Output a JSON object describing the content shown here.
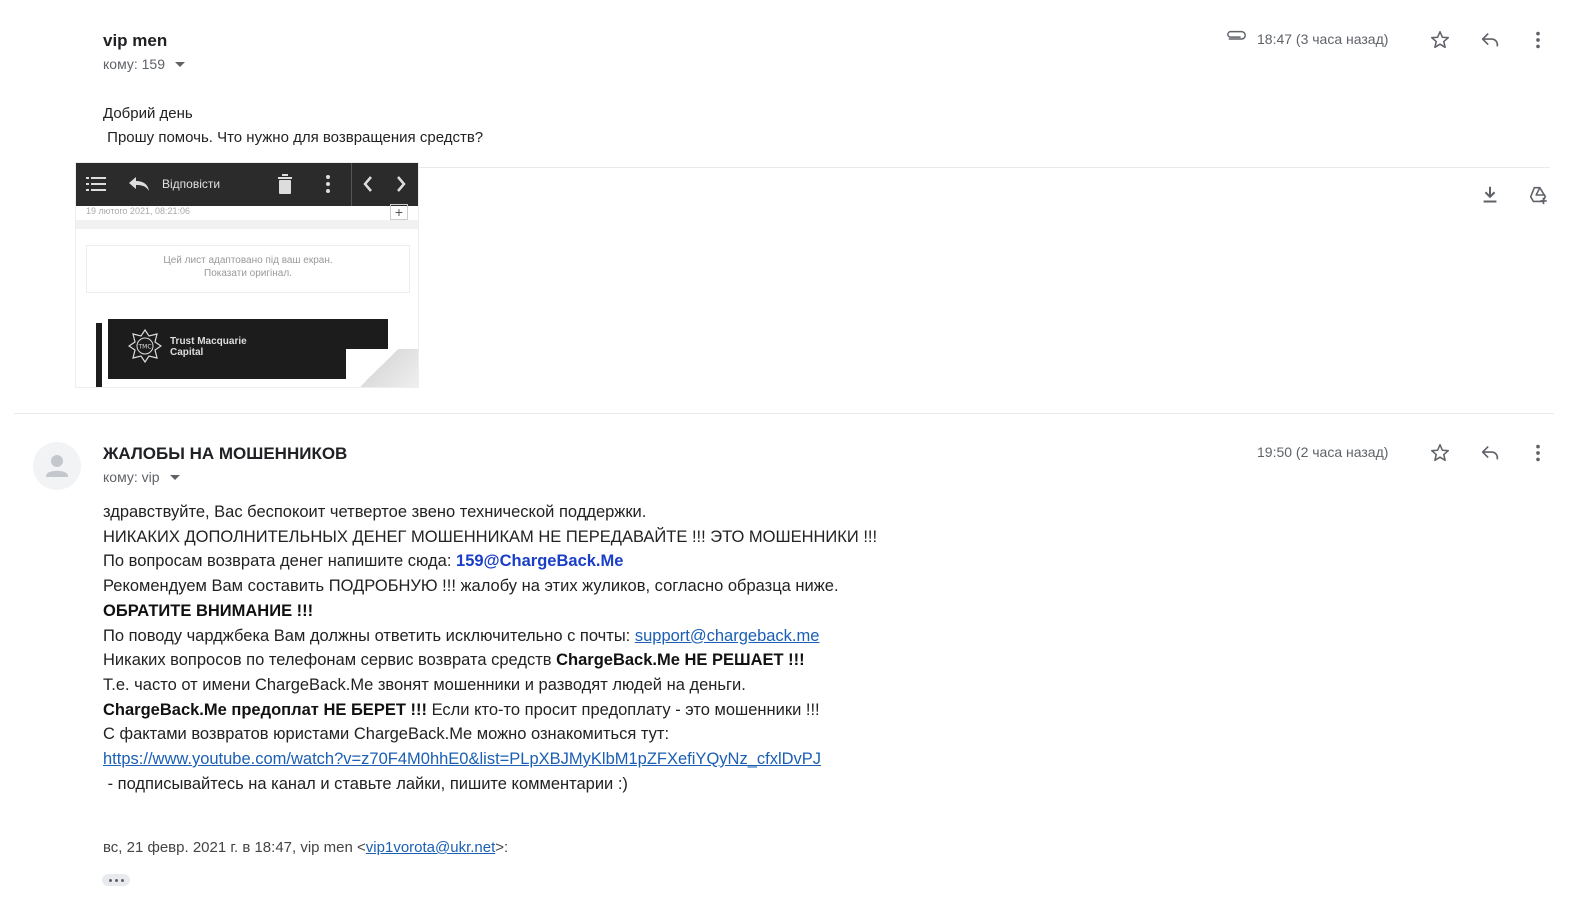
{
  "message1": {
    "sender": "vip men",
    "recipient": "кому: 159",
    "time": "18:47 (3 часа назад)",
    "body": [
      "Добрий день",
      " Прошу помочь. Что нужно для возвращения средств?"
    ],
    "attachment": {
      "toolbar_label": "Відповісти",
      "date": "19 лютого 2021, 08:21:06",
      "notice_line1": "Цей лист адаптовано під ваш екран.",
      "notice_line2": "Показати оригінал.",
      "brand_line1": "Trust Macquarie",
      "brand_line2": "Capital",
      "brand_mark": "TMC"
    },
    "icons": [
      "attachment-icon",
      "star-icon",
      "reply-icon",
      "more-icon",
      "download-icon",
      "drive-add-icon"
    ]
  },
  "message2": {
    "sender": "ЖАЛОБЫ НА МОШЕННИКОВ",
    "recipient": "кому: vip",
    "time": "19:50 (2 часа назад)",
    "line1": "здравствуйте, Вас беспокоит четвертое звено технической поддержки.",
    "line2": "НИКАКИХ ДОПОЛНИТЕЛЬНЫХ ДЕНЕГ МОШЕННИКАМ НЕ ПЕРЕДАВАЙТЕ !!! ЭТО МОШЕННИКИ !!!",
    "line3_prefix": "По вопросам возврата денег напишите сюда: ",
    "line3_email": "159@ChargeBack.Me",
    "line4": "Рекомендуем Вам составить ПОДРОБНУЮ !!! жалобу на этих жуликов, согласно образца ниже.",
    "line5": "ОБРАТИТЕ ВНИМАНИЕ !!!",
    "line6_prefix": "По поводу чарджбека Вам должны ответить исключительно с почты: ",
    "line6_email": "support@chargeback.me",
    "line7_prefix": "Никаких вопросов по телефонам сервис возврата средств ",
    "line7_bold": "ChargeBack.Me НЕ РЕШАЕТ !!!",
    "line8": "Т.е. часто от имени ChargeBack.Me звонят мошенники и разводят людей на деньги.",
    "line9_bold": "ChargeBack.Me предоплат НЕ БЕРЕТ !!!",
    "line9_rest": " Если кто-то просит предоплату - это мошенники !!!",
    "line10": "С фактами возвратов юристами ChargeBack.Me можно ознакомиться тут:",
    "line11_link": "https://www.youtube.com/watch?v=z70F4M0hhE0&list=PLpXBJMyKlbM1pZFXefiYQyNz_cfxlDvPJ",
    "line12": " - подписывайтесь на канал и ставьте лайки, пишите комментарии :)",
    "quote_prefix": "вс, 21 февр. 2021 г. в 18:47, vip men <",
    "quote_email": "vip1vorota@ukr.net",
    "quote_suffix": ">:"
  }
}
